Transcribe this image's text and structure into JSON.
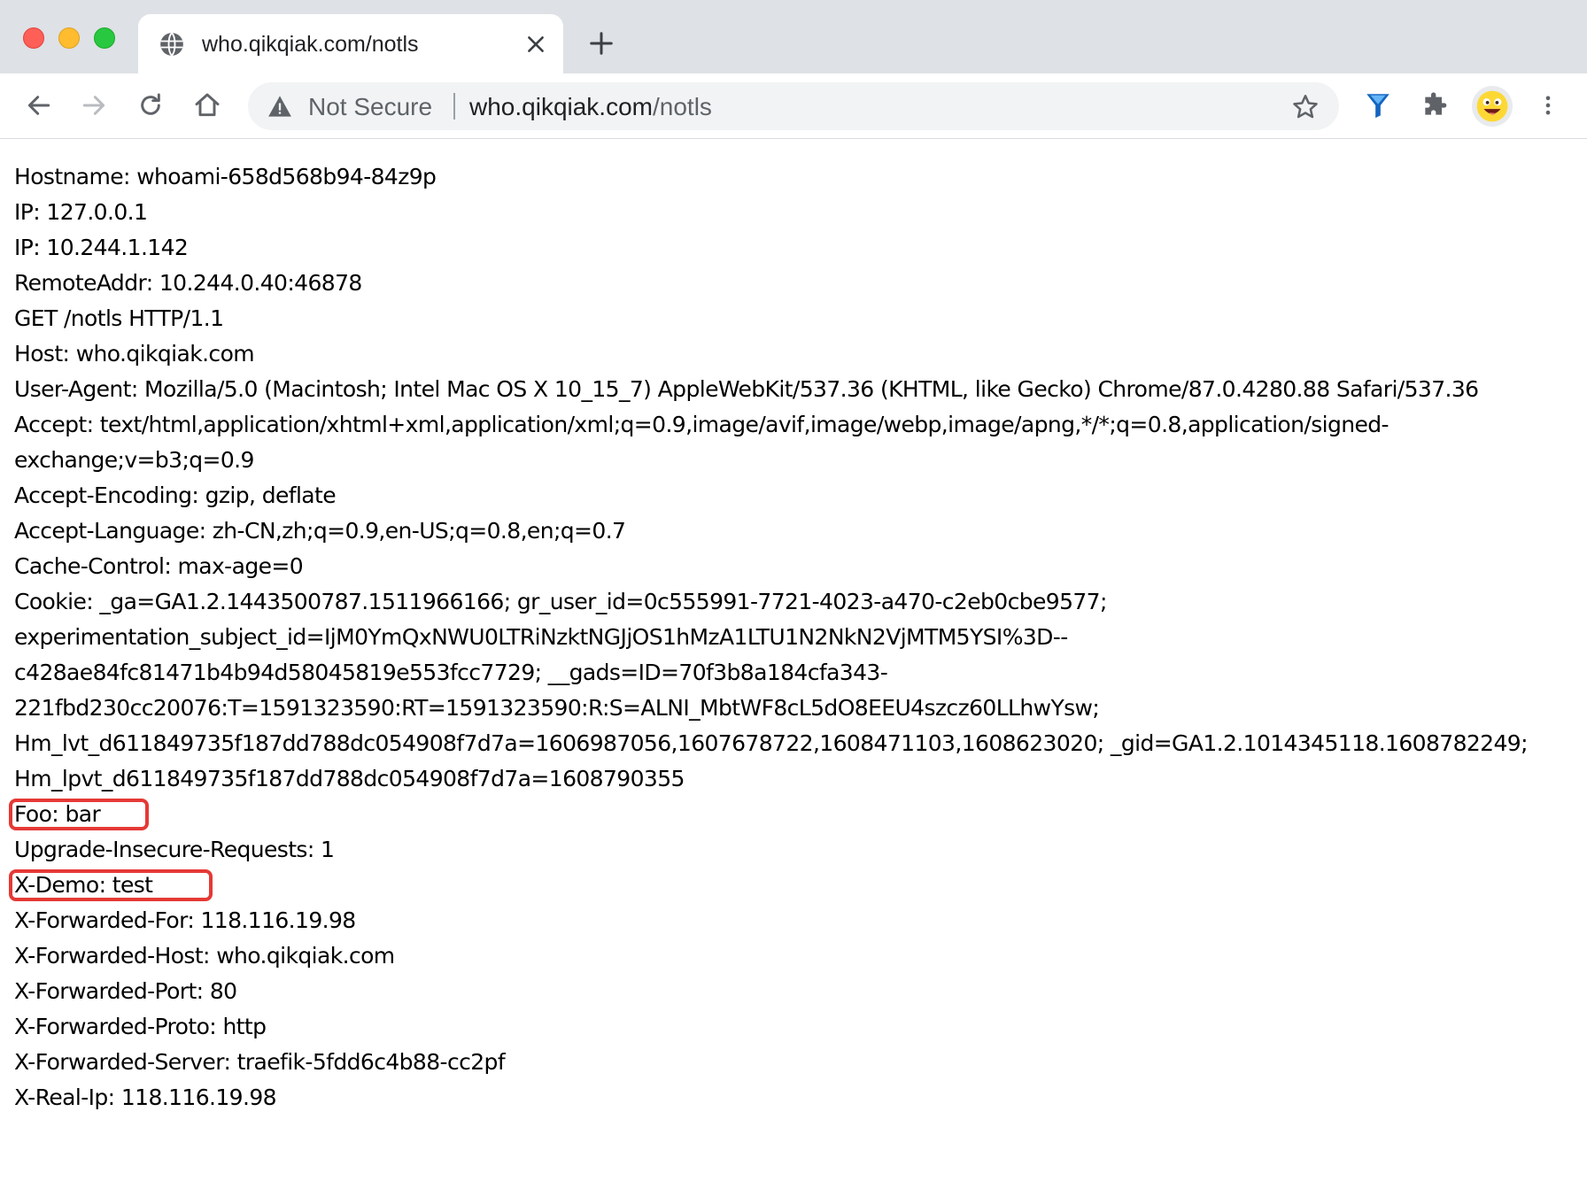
{
  "browser": {
    "tab": {
      "title": "who.qikqiak.com/notls"
    },
    "omnibox": {
      "security_label": "Not Secure",
      "url_host": "who.qikqiak.com",
      "url_path": "/notls"
    },
    "icons": {
      "favicon": "globe-icon",
      "tab_close": "close-icon",
      "new_tab": "plus-icon",
      "back": "back-arrow-icon",
      "forward": "forward-arrow-icon",
      "reload": "reload-icon",
      "home": "home-icon",
      "warning": "warning-icon",
      "bookmark": "star-icon",
      "extension_1": "funnel-extension-icon",
      "extensions": "puzzle-icon",
      "profile": "avatar-emoji",
      "menu": "kebab-menu-icon"
    }
  },
  "page": {
    "lines": [
      "Hostname: whoami-658d568b94-84z9p",
      "IP: 127.0.0.1",
      "IP: 10.244.1.142",
      "RemoteAddr: 10.244.0.40:46878",
      "GET /notls HTTP/1.1",
      "Host: who.qikqiak.com",
      "User-Agent: Mozilla/5.0 (Macintosh; Intel Mac OS X 10_15_7) AppleWebKit/537.36 (KHTML, like Gecko) Chrome/87.0.4280.88 Safari/537.36",
      "Accept: text/html,application/xhtml+xml,application/xml;q=0.9,image/avif,image/webp,image/apng,*/*;q=0.8,application/signed-exchange;v=b3;q=0.9",
      "Accept-Encoding: gzip, deflate",
      "Accept-Language: zh-CN,zh;q=0.9,en-US;q=0.8,en;q=0.7",
      "Cache-Control: max-age=0",
      "Cookie: _ga=GA1.2.1443500787.1511966166; gr_user_id=0c555991-7721-4023-a470-c2eb0cbe9577; experimentation_subject_id=IjM0YmQxNWU0LTRiNzktNGJjOS1hMzA1LTU1N2NkN2VjMTM5YSI%3D--c428ae84fc81471b4b94d58045819e553fcc7729; __gads=ID=70f3b8a184cfa343-221fbd230cc20076:T=1591323590:RT=1591323590:R:S=ALNI_MbtWF8cL5dO8EEU4szcz60LLhwYsw; Hm_lvt_d611849735f187dd788dc054908f7d7a=1606987056,1607678722,1608471103,1608623020; _gid=GA1.2.1014345118.1608782249; Hm_lpvt_d611849735f187dd788dc054908f7d7a=1608790355",
      "Foo: bar",
      "Upgrade-Insecure-Requests: 1",
      "X-Demo: test",
      "X-Forwarded-For: 118.116.19.98",
      "X-Forwarded-Host: who.qikqiak.com",
      "X-Forwarded-Port: 80",
      "X-Forwarded-Proto: http",
      "X-Forwarded-Server: traefik-5fdd6c4b88-cc2pf",
      "X-Real-Ip: 118.116.19.98"
    ],
    "accept_line_parts": [
      "Accept: text/html,application/xhtml+xml,application/xml;q=0.9,image/avif,image/webp,image/apng,*/*;q=0.8,application/signed-",
      "exchange;v=b3;q=0.9"
    ],
    "cookie_line_parts": [
      "Cookie: _ga=GA1.2.1443500787.1511966166; gr_user_id=0c555991-7721-4023-a470-c2eb0cbe9577;",
      "experimentation_subject_id=IjM0YmQxNWU0LTRiNzktNGJjOS1hMzA1LTU1N2NkN2VjMTM5YSI%3D--",
      "c428ae84fc81471b4b94d58045819e553fcc7729; __gads=ID=70f3b8a184cfa343-",
      "221fbd230cc20076:T=1591323590:RT=1591323590:R:S=ALNI_MbtWF8cL5dO8EEU4szcz60LLhwYsw;",
      "Hm_lvt_d611849735f187dd788dc054908f7d7a=1606987056,1607678722,1608471103,1608623020; _gid=GA1.2.1014345118.1608782249;",
      "Hm_lpvt_d611849735f187dd788dc054908f7d7a=1608790355"
    ],
    "highlight_color": "#e53935"
  },
  "colors": {
    "tabstrip_bg": "#dee1e6",
    "omnibox_bg": "#f1f3f4",
    "text": "#000000"
  }
}
